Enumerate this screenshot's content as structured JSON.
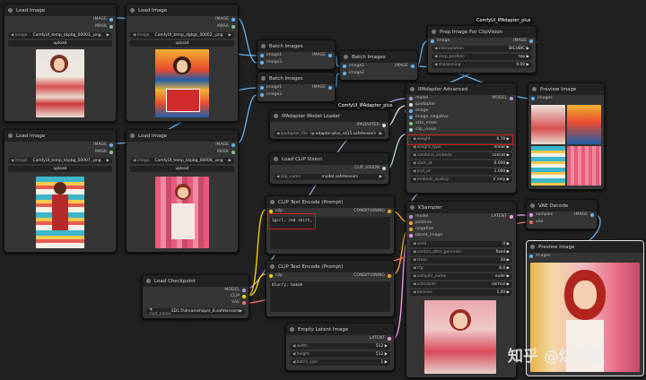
{
  "load_image_1": {
    "title": "Load Image",
    "out1": "IMAGE",
    "out2": "MASK",
    "file_label": "image",
    "file": "ComfyUI_temp_kkpbg_00003_.png",
    "upload": "upload"
  },
  "load_image_2": {
    "title": "Load Image",
    "out1": "IMAGE",
    "out2": "MASK",
    "file_label": "image",
    "file": "ComfyUI_temp_dgkgs_00002_.png",
    "upload": "upload"
  },
  "load_image_3": {
    "title": "Load Image",
    "out1": "IMAGE",
    "out2": "MASK",
    "file_label": "image",
    "file": "ComfyUI_temp_kkpbg_00007_.png",
    "upload": "upload"
  },
  "load_image_4": {
    "title": "Load Image",
    "out1": "IMAGE",
    "out2": "MASK",
    "file_label": "image",
    "file": "ComfyUI_temp_kkpbg_00008_.png",
    "upload": "upload"
  },
  "batch_1": {
    "title": "Batch Images",
    "in1": "image1",
    "in2": "image2",
    "out": "IMAGE"
  },
  "batch_2": {
    "title": "Batch Images",
    "in1": "image1",
    "in2": "image2",
    "out": "IMAGE"
  },
  "batch_3": {
    "title": "Batch Images",
    "in1": "image1",
    "in2": "image2",
    "out": "IMAGE"
  },
  "prep": {
    "tag": "ComfyUI_IPAdapter_plus",
    "title": "Prep Image For ClipVision",
    "in": "image",
    "out": "IMAGE",
    "widgets": [
      {
        "l": "interpolation",
        "v": "BICUBIC"
      },
      {
        "l": "crop_position",
        "v": "top"
      },
      {
        "l": "sharpening",
        "v": "0.00"
      }
    ]
  },
  "ipadapter_loader": {
    "title": "IPAdapter Model Loader",
    "out": "IPADAPTER",
    "file_label": "ipadapter_file",
    "file": "ip-adapter-plus_sd15.safetensors"
  },
  "clip_vision": {
    "title": "Load CLIP Vision",
    "out": "CLIP_VISION",
    "file_label": "clip_name",
    "file": "model.safetensors"
  },
  "ipadapter_adv": {
    "tag": "ComfyUI_IPAdapter_plus",
    "title": "IPAdapter Advanced",
    "out": "MODEL",
    "inputs": [
      "model",
      "ipadapter",
      "image",
      "image_negative",
      "attn_mask",
      "clip_vision"
    ],
    "widgets": [
      {
        "l": "weight",
        "v": "0.70"
      },
      {
        "l": "weight_type",
        "v": "linear"
      },
      {
        "l": "combine_embeds",
        "v": "concat"
      },
      {
        "l": "start_at",
        "v": "0.000"
      },
      {
        "l": "end_at",
        "v": "1.000"
      },
      {
        "l": "embeds_scaling",
        "v": "V only"
      }
    ]
  },
  "preview_small": {
    "title": "Preview Image",
    "in": "images"
  },
  "clip_pos": {
    "title": "CLIP Text Encode (Prompt)",
    "in": "clip",
    "out": "CONDITIONING",
    "text": "1girl, red skirt,"
  },
  "clip_neg": {
    "title": "CLIP Text Encode (Prompt)",
    "in": "clip",
    "out": "CONDITIONING",
    "text": "blurry, bokeh"
  },
  "checkpoint": {
    "title": "Load Checkpoint",
    "out": [
      "MODEL",
      "CLIP",
      "VAE"
    ],
    "file_label": "ckpt_name",
    "file": "SD1.5\\dreamshaper_8.safetensors"
  },
  "latent": {
    "title": "Empty Latent Image",
    "out": "LATENT",
    "widgets": [
      {
        "l": "width",
        "v": "512"
      },
      {
        "l": "height",
        "v": "512"
      },
      {
        "l": "batch_size",
        "v": "1"
      }
    ]
  },
  "ksampler": {
    "title": "KSampler",
    "out": "LATENT",
    "inputs": [
      "model",
      "positive",
      "negative",
      "latent_image"
    ],
    "widgets": [
      {
        "l": "seed",
        "v": "0"
      },
      {
        "l": "control_after_generate",
        "v": "fixed"
      },
      {
        "l": "steps",
        "v": "20"
      },
      {
        "l": "cfg",
        "v": "8.0"
      },
      {
        "l": "sampler_name",
        "v": "euler"
      },
      {
        "l": "scheduler",
        "v": "normal"
      },
      {
        "l": "denoise",
        "v": "1.00"
      }
    ]
  },
  "vae_decode": {
    "title": "VAE Decode",
    "in1": "samples",
    "in2": "vae",
    "out": "IMAGE"
  },
  "preview_big": {
    "title": "Preview Image",
    "in": "images"
  },
  "watermark": "知乎 @煤老板",
  "colors": {
    "image": "#64b5f6",
    "mask": "#81c784",
    "model": "#b39ddb",
    "clip": "#ffd500",
    "vae": "#ff6e6e",
    "conditioning": "#ffa931",
    "latent": "#ff9cf9",
    "clip_vision": "#a8dadc",
    "ipadapter": "#e0e0e0",
    "highlight": "#d21d1d"
  }
}
